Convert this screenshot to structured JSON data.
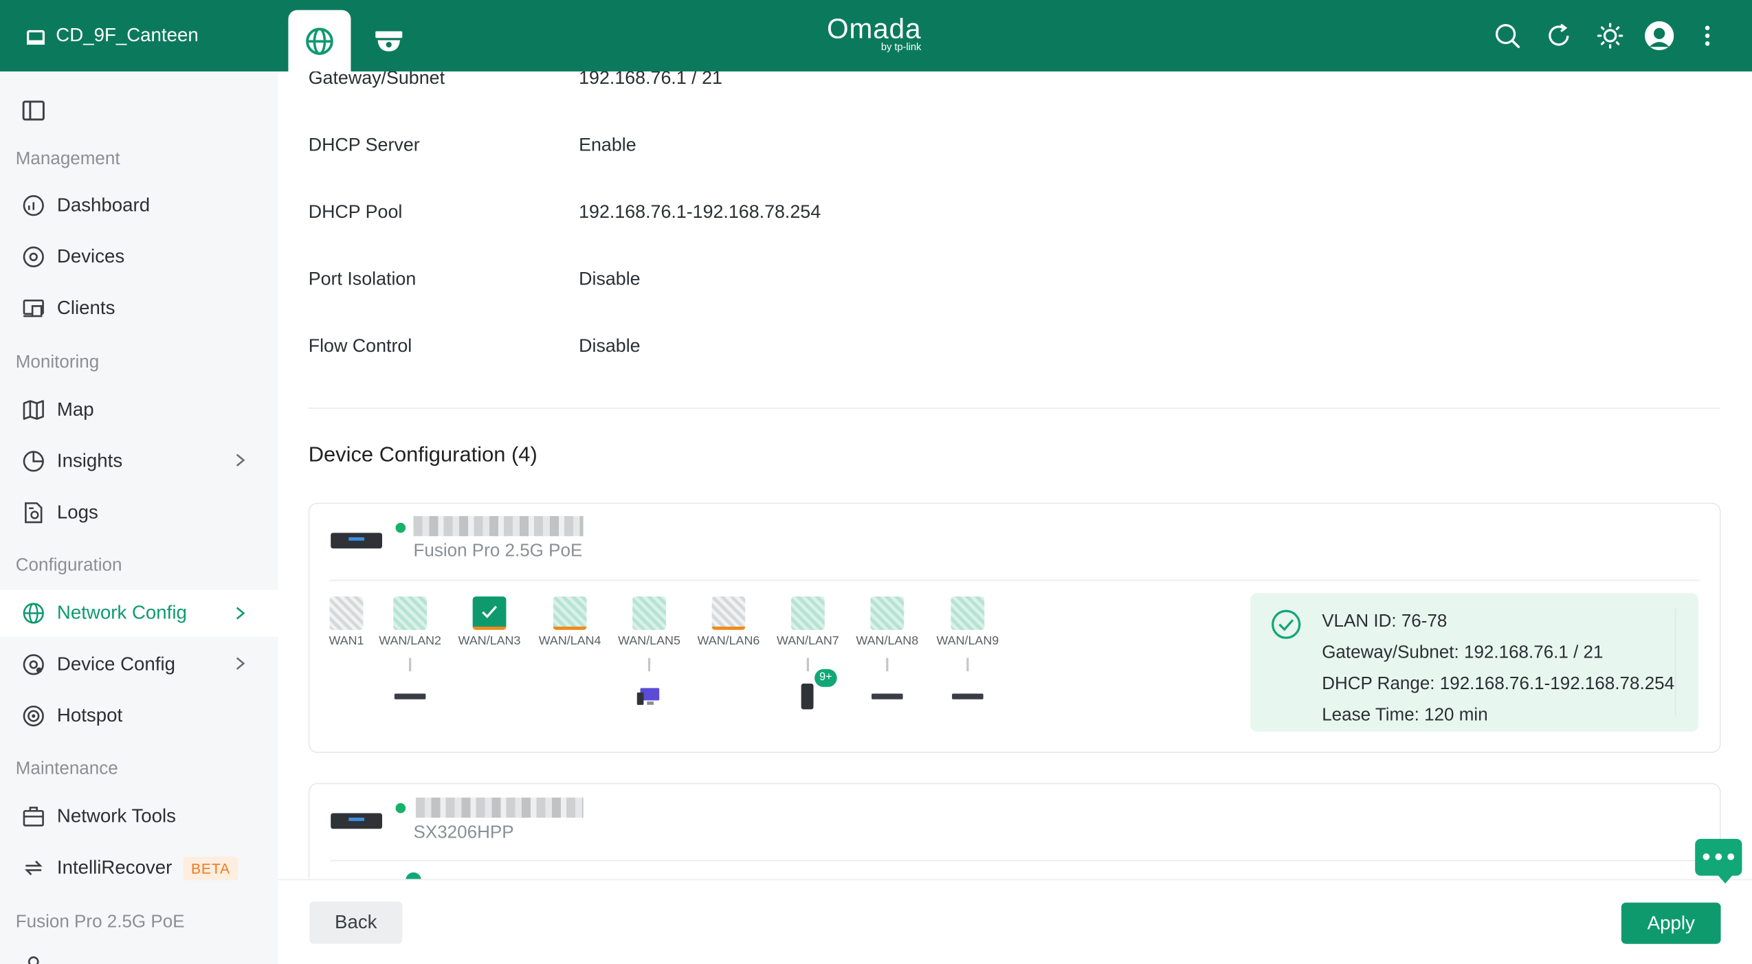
{
  "header": {
    "site_name": "CD_9F_Canteen",
    "tabs": [
      {
        "icon": "globe-icon",
        "active": true
      },
      {
        "icon": "camera-icon",
        "active": false
      }
    ],
    "logo_main": "Omada",
    "logo_sub": "by tp-link",
    "actions": [
      "search-icon",
      "refresh-icon",
      "theme-icon",
      "avatar",
      "more-icon"
    ]
  },
  "sidebar": {
    "toggle_icon": "sidebar-toggle-icon",
    "sections": {
      "management": "Management",
      "monitoring": "Monitoring",
      "configuration": "Configuration",
      "maintenance": "Maintenance",
      "device": "Fusion Pro 2.5G PoE"
    },
    "items": {
      "dashboard": "Dashboard",
      "devices": "Devices",
      "clients": "Clients",
      "map": "Map",
      "insights": "Insights",
      "logs": "Logs",
      "network_config": "Network Config",
      "device_config": "Device Config",
      "hotspot": "Hotspot",
      "network_tools": "Network Tools",
      "intellirecover": "IntelliRecover",
      "beta": "BETA"
    }
  },
  "details": [
    {
      "key": "Gateway/Subnet",
      "value": "192.168.76.1 / 21"
    },
    {
      "key": "DHCP Server",
      "value": "Enable"
    },
    {
      "key": "DHCP Pool",
      "value": "192.168.76.1-192.168.78.254"
    },
    {
      "key": "Port Isolation",
      "value": "Disable"
    },
    {
      "key": "Flow Control",
      "value": "Disable"
    }
  ],
  "device_config": {
    "title": "Device Configuration (4)",
    "devices": [
      {
        "model": "Fusion Pro 2.5G PoE",
        "status_color": "#17b26a",
        "ports": [
          "WAN1",
          "WAN/LAN2",
          "WAN/LAN3",
          "WAN/LAN4",
          "WAN/LAN5",
          "WAN/LAN6",
          "WAN/LAN7",
          "WAN/LAN8",
          "WAN/LAN9"
        ],
        "client_badge": "9+",
        "info": {
          "vlan": "VLAN ID: 76-78",
          "gateway": "Gateway/Subnet: 192.168.76.1 / 21",
          "dhcp_range": "DHCP Range: 192.168.76.1-192.168.78.254",
          "lease": "Lease Time: 120 min"
        }
      },
      {
        "model": "SX3206HPP",
        "status_color": "#17b26a"
      }
    ]
  },
  "footer": {
    "back": "Back",
    "apply": "Apply"
  },
  "colors": {
    "brand": "#0b7a5c",
    "accent": "#0f9a6e",
    "warning": "#f08a1a"
  }
}
